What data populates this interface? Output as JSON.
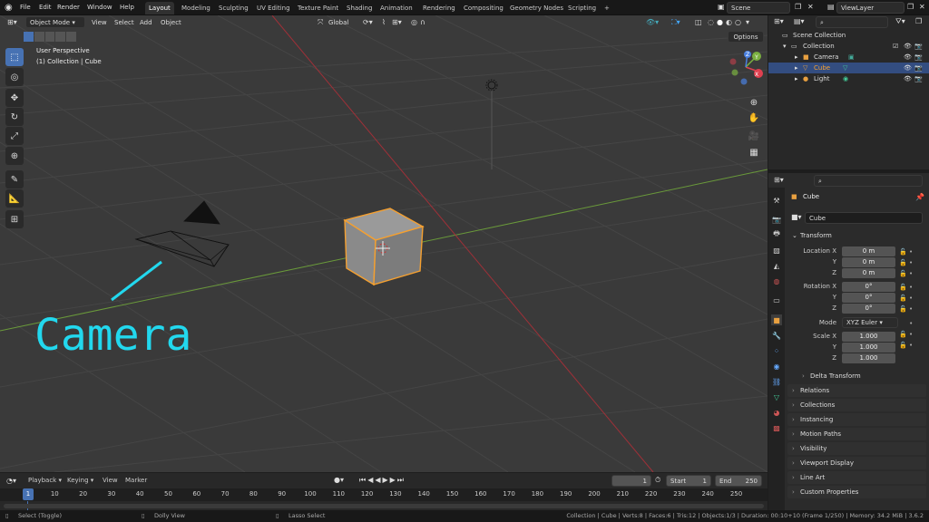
{
  "topbar": {
    "menus": [
      "File",
      "Edit",
      "Render",
      "Window",
      "Help"
    ],
    "workspaces": [
      "Layout",
      "Modeling",
      "Sculpting",
      "UV Editing",
      "Texture Paint",
      "Shading",
      "Animation",
      "Rendering",
      "Compositing",
      "Geometry Nodes",
      "Scripting"
    ],
    "add_tab": "+",
    "scene": "Scene",
    "view_layer": "ViewLayer"
  },
  "viewport": {
    "mode": "Object Mode",
    "menus": [
      "View",
      "Select",
      "Add",
      "Object"
    ],
    "orientation": "Global",
    "options": "Options",
    "info_line1": "User Perspective",
    "info_line2": "(1) Collection | Cube",
    "annotation_text": "Camera",
    "gizmo": {
      "x": "X",
      "y": "Y",
      "z": "Z"
    }
  },
  "outliner": {
    "search_placeholder": "",
    "rows": [
      {
        "label": "Scene Collection",
        "icon": "scene-collection-icon"
      },
      {
        "label": "Collection",
        "icon": "collection-icon"
      },
      {
        "label": "Camera",
        "icon": "camera-object-icon"
      },
      {
        "label": "Cube",
        "icon": "mesh-object-icon"
      },
      {
        "label": "Light",
        "icon": "light-object-icon"
      }
    ]
  },
  "properties": {
    "object_name": "Cube",
    "datablock_name": "Cube",
    "transform_title": "Transform",
    "location": {
      "label": "Location X",
      "y": "Y",
      "z": "Z",
      "x_val": "0 m",
      "y_val": "0 m",
      "z_val": "0 m"
    },
    "rotation": {
      "label": "Rotation X",
      "y": "Y",
      "z": "Z",
      "x_val": "0°",
      "y_val": "0°",
      "z_val": "0°"
    },
    "mode": {
      "label": "Mode",
      "value": "XYZ Euler"
    },
    "scale": {
      "label": "Scale X",
      "y": "Y",
      "z": "Z",
      "x_val": "1.000",
      "y_val": "1.000",
      "z_val": "1.000"
    },
    "panels": [
      "Delta Transform",
      "Relations",
      "Collections",
      "Instancing",
      "Motion Paths",
      "Visibility",
      "Viewport Display",
      "Line Art",
      "Custom Properties"
    ]
  },
  "timeline": {
    "menus": [
      "Playback",
      "Keying",
      "View",
      "Marker"
    ],
    "current_frame": "1",
    "start_label": "Start",
    "start": "1",
    "end_label": "End",
    "end": "250",
    "frames": [
      "1",
      "10",
      "20",
      "30",
      "40",
      "50",
      "60",
      "70",
      "80",
      "90",
      "100",
      "110",
      "120",
      "130",
      "140",
      "150",
      "160",
      "170",
      "180",
      "190",
      "200",
      "210",
      "220",
      "230",
      "240",
      "250"
    ]
  },
  "statusbar": {
    "select": "Select (Toggle)",
    "dolly": "Dolly View",
    "lasso": "Lasso Select",
    "stats": "Collection | Cube | Verts:8 | Faces:6 | Tris:12 | Objects:1/3 | Duration: 00:10+10 (Frame 1/250) | Memory: 34.2 MiB | 3.6.2"
  },
  "colors": {
    "accent": "#4772b3",
    "selection_orange": "#f5a030",
    "annotation_cyan": "#22d8ee",
    "x_axis": "#e04050",
    "y_axis": "#7ab040",
    "z_axis": "#4a80e0"
  }
}
